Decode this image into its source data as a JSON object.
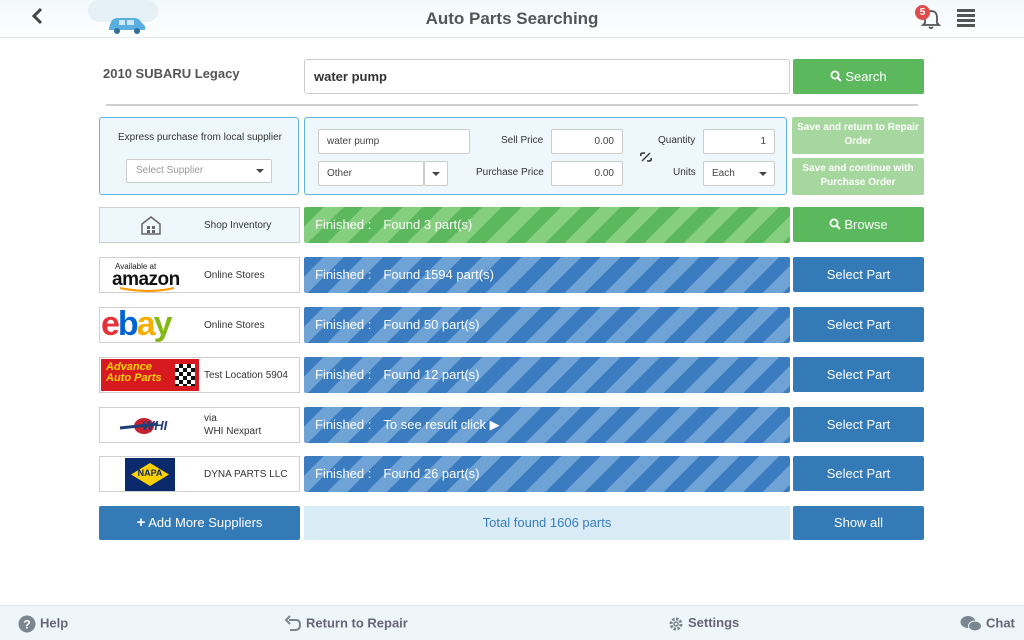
{
  "header": {
    "title": "Auto Parts Searching",
    "notification_count": "5"
  },
  "search": {
    "vehicle": "2010 SUBARU Legacy",
    "query": "water pump",
    "search_label": "Search"
  },
  "express": {
    "title": "Express purchase from local supplier",
    "supplier_placeholder": "Select Supplier"
  },
  "details": {
    "part_name": "water pump",
    "category": "Other",
    "sell_price_label": "Sell Price",
    "sell_price": "0.00",
    "purchase_price_label": "Purchase Price",
    "purchase_price": "0.00",
    "quantity_label": "Quantity",
    "quantity": "1",
    "units_label": "Units",
    "units": "Each",
    "save_repair_label": "Save and return to Repair Order",
    "save_purchase_label": "Save and continue with Purchase Order"
  },
  "suppliers": [
    {
      "logo": "shop-inventory",
      "name": "Shop Inventory",
      "status_prefix": "Finished :",
      "status": "Found 3 part(s)",
      "action": "Browse"
    },
    {
      "logo": "amazon",
      "logo_text_small": "Available at",
      "logo_text": "amazon",
      "name": "Online Stores",
      "status_prefix": "Finished :",
      "status": "Found 1594 part(s)",
      "action": "Select Part"
    },
    {
      "logo": "ebay",
      "logo_text": "ebay",
      "name": "Online Stores",
      "status_prefix": "Finished :",
      "status": "Found 50 part(s)",
      "action": "Select Part"
    },
    {
      "logo": "advance-auto-parts",
      "logo_text": "Advance Auto Parts",
      "name": "Test Location 5904",
      "status_prefix": "Finished :",
      "status": "Found 12 part(s)",
      "action": "Select Part"
    },
    {
      "logo": "whi",
      "logo_text": "WHI",
      "name_line1": "via",
      "name_line2": "WHI Nexpart",
      "status_prefix": "Finished :",
      "status": "To see result click ▶",
      "action": "Select Part"
    },
    {
      "logo": "napa",
      "logo_text": "NAPA",
      "name": "DYNA PARTS LLC",
      "status_prefix": "Finished :",
      "status": "Found 26 part(s)",
      "action": "Select Part"
    }
  ],
  "bottom": {
    "add_label": "Add More Suppliers",
    "total": "Total found 1606 parts",
    "show_all": "Show all"
  },
  "footer": {
    "help": "Help",
    "return": "Return to Repair",
    "settings": "Settings",
    "chat": "Chat"
  },
  "colors": {
    "green": "#5cb85c",
    "blue": "#337ab7",
    "badge": "#e04b4b"
  }
}
